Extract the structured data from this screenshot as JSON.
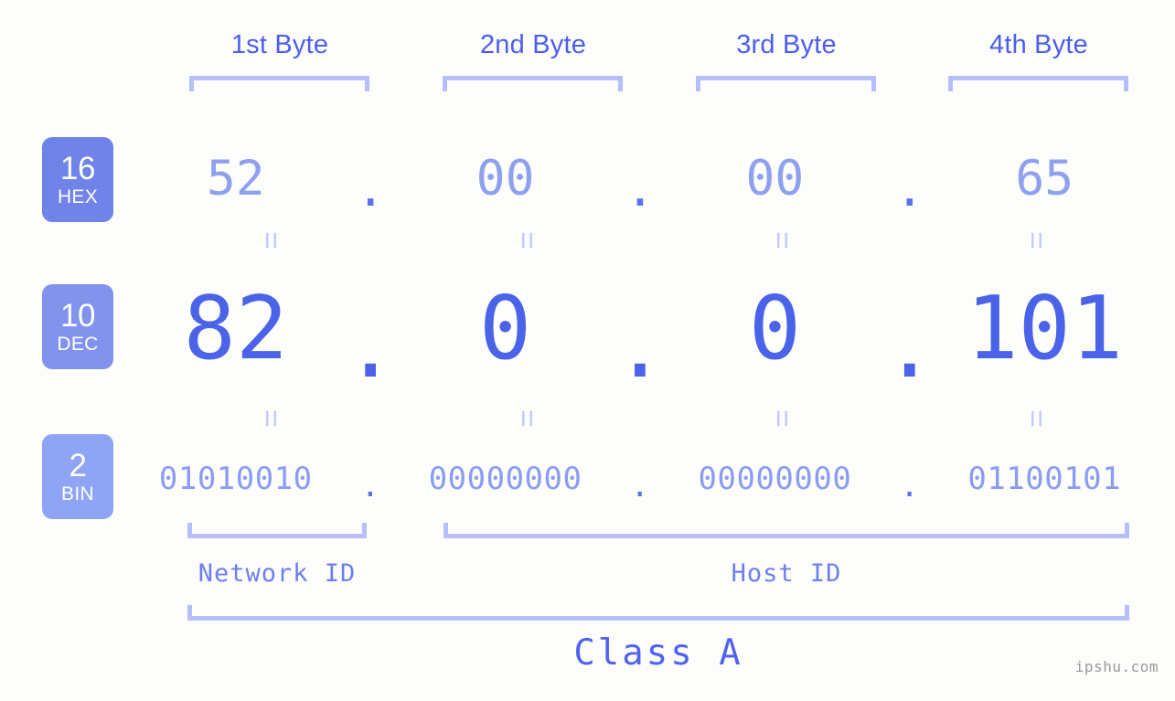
{
  "headers": {
    "bytes": [
      "1st Byte",
      "2nd Byte",
      "3rd Byte",
      "4th Byte"
    ]
  },
  "rows": [
    {
      "base": "16",
      "unit": "HEX",
      "badge_color": "#7083e8",
      "text_color": "#8fa0ef",
      "octets": [
        "52",
        "00",
        "00",
        "65"
      ],
      "separator": "."
    },
    {
      "base": "10",
      "unit": "DEC",
      "badge_color": "#8293ee",
      "text_color": "#4a63e8",
      "octets": [
        "82",
        "0",
        "0",
        "101"
      ],
      "separator": "."
    },
    {
      "base": "2",
      "unit": "BIN",
      "badge_color": "#8fa4f5",
      "text_color": "#8a9cf3",
      "octets": [
        "01010010",
        "00000000",
        "00000000",
        "01100101"
      ],
      "separator": "."
    }
  ],
  "equals_marks": {
    "glyph": "=",
    "count_per_gap": 4,
    "color": "#c3cafc"
  },
  "segments": {
    "network_id": "Network ID",
    "host_id": "Host ID"
  },
  "class": {
    "label": "Class A"
  },
  "watermark": {
    "text": "ipshu.com"
  },
  "colors": {
    "background": "#fdfefb",
    "bracket": "#b6bffb",
    "header_text": "#4c5ef0",
    "accent": "#4a63e8"
  }
}
